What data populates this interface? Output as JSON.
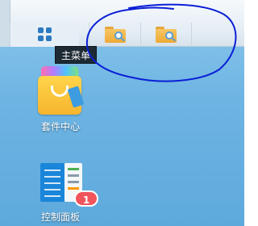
{
  "taskbar": {
    "main_menu_icon": "grid-icon",
    "pinned_apps": [
      {
        "icon": "folder-search-icon"
      },
      {
        "icon": "folder-search-icon"
      }
    ]
  },
  "tooltip": {
    "text": "主菜单"
  },
  "desktop": {
    "shortcuts": [
      {
        "label": "套件中心",
        "icon": "package-center-icon"
      },
      {
        "label": "控制面板",
        "icon": "control-panel-icon",
        "badge": "1"
      }
    ]
  },
  "annotation": {
    "color": "#0a1fd6",
    "shape": "hand-drawn-circle"
  },
  "colors": {
    "accent": "#2c79c2",
    "badge": "#f2545b",
    "folder": "#eeaa35"
  }
}
